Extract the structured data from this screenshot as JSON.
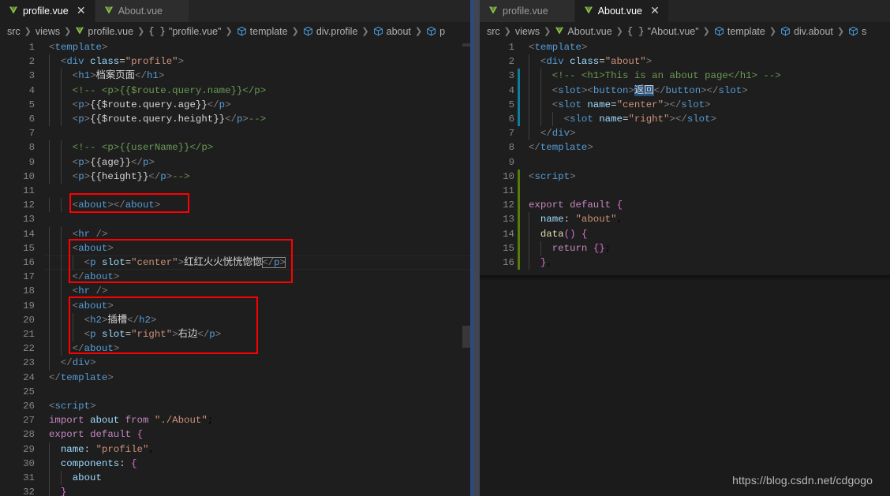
{
  "theme": {
    "editor_bg": "#1e1e1e",
    "tabbar_bg": "#252526",
    "inactive_tab_bg": "#2d2d2d",
    "outer_bg": "#1b1b1b",
    "annotation_color": "#ff0000",
    "git_modified": "#0c7d9d",
    "git_added": "#587c0c",
    "selection": "#264f78",
    "vue_icon_color": "#8dc149"
  },
  "left_pane": {
    "tabs": [
      {
        "label": "profile.vue",
        "icon": "vue-file-icon",
        "active": true,
        "closable": true
      },
      {
        "label": "About.vue",
        "icon": "vue-file-icon",
        "active": false,
        "closable": false
      }
    ],
    "breadcrumb": [
      {
        "text": "src",
        "icon": ""
      },
      {
        "text": "views",
        "icon": ""
      },
      {
        "text": "profile.vue",
        "icon": "vue-file-icon"
      },
      {
        "text": "\"profile.vue\"",
        "icon": "braces-icon"
      },
      {
        "text": "template",
        "icon": "symbol-cube-icon"
      },
      {
        "text": "div.profile",
        "icon": "symbol-cube-icon"
      },
      {
        "text": "about",
        "icon": "symbol-cube-icon"
      },
      {
        "text": "p",
        "icon": "symbol-cube-icon"
      }
    ],
    "current_line": 16,
    "first_line": 1,
    "last_line": 32,
    "code_lines": [
      "<template>",
      "  <div class=\"profile\">",
      "    <h1>档案页面</h1>",
      "    <!-- <p>{{$route.query.name}}</p>",
      "    <p>{{$route.query.age}}</p>",
      "    <p>{{$route.query.height}}</p>-->",
      "",
      "    <!-- <p>{{userName}}</p>",
      "    <p>{{age}}</p>",
      "    <p>{{height}}</p>-->",
      "",
      "    <about></about>",
      "",
      "    <hr />",
      "    <about>",
      "      <p slot=\"center\">红红火火恍恍惚惚</p>",
      "    </about>",
      "    <hr />",
      "    <about>",
      "      <h2>插槽</h2>",
      "      <p slot=\"right\">右边</p>",
      "    </about>",
      "  </div>",
      "</template>",
      "",
      "<script>",
      "import about from \"./About\";",
      "export default {",
      "  name: \"profile\",",
      "  components: {",
      "    about",
      "  }"
    ],
    "annotations": [
      {
        "name": "redbox-about-empty",
        "lines": "12"
      },
      {
        "name": "redbox-about-center-slot",
        "lines": "15-17"
      },
      {
        "name": "redbox-about-right-slot",
        "lines": "19-22"
      }
    ]
  },
  "right_pane": {
    "tabs": [
      {
        "label": "profile.vue",
        "icon": "vue-file-icon",
        "active": false,
        "closable": false
      },
      {
        "label": "About.vue",
        "icon": "vue-file-icon",
        "active": true,
        "closable": true
      }
    ],
    "breadcrumb": [
      {
        "text": "src",
        "icon": ""
      },
      {
        "text": "views",
        "icon": ""
      },
      {
        "text": "About.vue",
        "icon": "vue-file-icon"
      },
      {
        "text": "\"About.vue\"",
        "icon": "braces-icon"
      },
      {
        "text": "template",
        "icon": "symbol-cube-icon"
      },
      {
        "text": "div.about",
        "icon": "symbol-cube-icon"
      },
      {
        "text": "s",
        "icon": "symbol-cube-icon"
      }
    ],
    "first_line": 1,
    "last_line": 16,
    "selection_text": "返回",
    "code_lines": [
      "<template>",
      "  <div class=\"about\">",
      "    <!-- <h1>This is an about page</h1> -->",
      "    <slot><button>返回</button></slot>",
      "    <slot name=\"center\"></slot>",
      "      <slot name=\"right\"></slot>",
      "  </div>",
      "</template>",
      "",
      "<script>",
      "",
      "export default {",
      "  name: \"about\",",
      "  data() {",
      "    return {};",
      "  },"
    ],
    "git_modified_lines": "3-6",
    "git_added_lines": "10-16"
  },
  "watermark": {
    "text": "https://blog.csdn.net/cdgogo"
  }
}
